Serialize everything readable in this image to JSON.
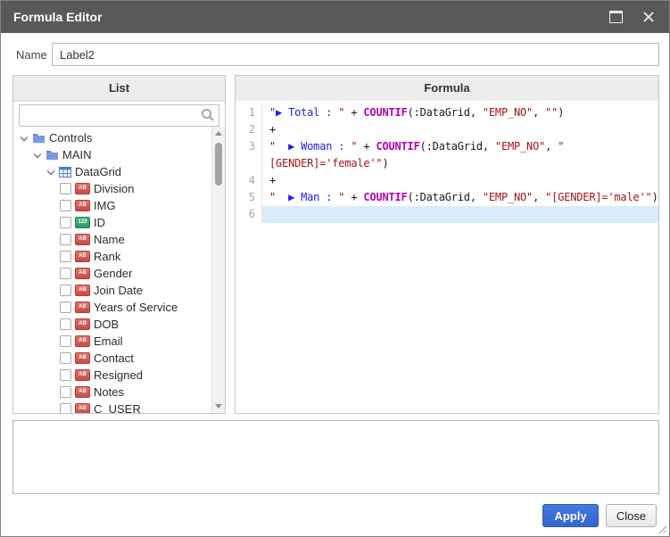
{
  "window": {
    "title": "Formula Editor"
  },
  "name_field": {
    "label": "Name",
    "value": "Label2"
  },
  "colors": {
    "titlebar": "#595959",
    "accent_blue": "#3a6bd3",
    "current_line_highlight": "#d9ecfb"
  },
  "list_panel": {
    "header": "List",
    "search_value": "",
    "field_icon_text": {
      "text": "AB",
      "number": "123"
    },
    "tree": [
      {
        "label": "Controls",
        "level": 0,
        "icon": "folder",
        "expandable": true,
        "checkbox": false
      },
      {
        "label": "MAIN",
        "level": 1,
        "icon": "folder",
        "expandable": true,
        "checkbox": false
      },
      {
        "label": "DataGrid",
        "level": 2,
        "icon": "grid",
        "expandable": true,
        "checkbox": false
      },
      {
        "label": "Division",
        "level": 3,
        "icon": "text",
        "checkbox": true,
        "checked": false
      },
      {
        "label": "IMG",
        "level": 3,
        "icon": "text",
        "checkbox": true,
        "checked": false
      },
      {
        "label": "ID",
        "level": 3,
        "icon": "number",
        "checkbox": true,
        "checked": false
      },
      {
        "label": "Name",
        "level": 3,
        "icon": "text",
        "checkbox": true,
        "checked": false
      },
      {
        "label": "Rank",
        "level": 3,
        "icon": "text",
        "checkbox": true,
        "checked": false
      },
      {
        "label": "Gender",
        "level": 3,
        "icon": "text",
        "checkbox": true,
        "checked": false
      },
      {
        "label": "Join Date",
        "level": 3,
        "icon": "text",
        "checkbox": true,
        "checked": false
      },
      {
        "label": "Years of Service",
        "level": 3,
        "icon": "text",
        "checkbox": true,
        "checked": false
      },
      {
        "label": "DOB",
        "level": 3,
        "icon": "text",
        "checkbox": true,
        "checked": false
      },
      {
        "label": "Email",
        "level": 3,
        "icon": "text",
        "checkbox": true,
        "checked": false
      },
      {
        "label": "Contact",
        "level": 3,
        "icon": "text",
        "checkbox": true,
        "checked": false
      },
      {
        "label": "Resigned",
        "level": 3,
        "icon": "text",
        "checkbox": true,
        "checked": false
      },
      {
        "label": "Notes",
        "level": 3,
        "icon": "text",
        "checkbox": true,
        "checked": false
      },
      {
        "label": "C_USER",
        "level": 3,
        "icon": "text",
        "checkbox": true,
        "checked": false
      }
    ]
  },
  "formula_panel": {
    "header": "Formula",
    "syntax_colors": {
      "str": "#a31515",
      "blue": "#1c1cf0",
      "kw": "#b400b4",
      "plain": "#1a1a1a"
    },
    "rows": [
      {
        "num": "1",
        "segments": [
          {
            "t": "\"",
            "s": "str"
          },
          {
            "t": "▶ Total : ",
            "s": "blue"
          },
          {
            "t": "\"",
            "s": "str"
          },
          {
            "t": " + ",
            "s": "plain"
          },
          {
            "t": "COUNTIF",
            "s": "kw"
          },
          {
            "t": "(:DataGrid, ",
            "s": "plain"
          },
          {
            "t": "\"EMP_NO\"",
            "s": "str"
          },
          {
            "t": ", ",
            "s": "plain"
          },
          {
            "t": "\"\"",
            "s": "str"
          },
          {
            "t": ")",
            "s": "plain"
          }
        ]
      },
      {
        "num": "2",
        "segments": [
          {
            "t": "+",
            "s": "plain"
          }
        ]
      },
      {
        "num": "3",
        "segments": [
          {
            "t": "\"  ",
            "s": "str"
          },
          {
            "t": "▶ Woman : ",
            "s": "blue"
          },
          {
            "t": "\"",
            "s": "str"
          },
          {
            "t": " + ",
            "s": "plain"
          },
          {
            "t": "COUNTIF",
            "s": "kw"
          },
          {
            "t": "(:DataGrid, ",
            "s": "plain"
          },
          {
            "t": "\"EMP_NO\"",
            "s": "str"
          },
          {
            "t": ", ",
            "s": "plain"
          },
          {
            "t": "\"",
            "s": "str"
          }
        ]
      },
      {
        "num": "",
        "segments": [
          {
            "t": "[GENDER]='female'\"",
            "s": "str"
          },
          {
            "t": ")",
            "s": "plain"
          }
        ]
      },
      {
        "num": "4",
        "segments": [
          {
            "t": "+",
            "s": "plain"
          }
        ]
      },
      {
        "num": "5",
        "segments": [
          {
            "t": "\"  ",
            "s": "str"
          },
          {
            "t": "▶ Man : ",
            "s": "blue"
          },
          {
            "t": "\"",
            "s": "str"
          },
          {
            "t": " + ",
            "s": "plain"
          },
          {
            "t": "COUNTIF",
            "s": "kw"
          },
          {
            "t": "(:DataGrid, ",
            "s": "plain"
          },
          {
            "t": "\"EMP_NO\"",
            "s": "str"
          },
          {
            "t": ", ",
            "s": "plain"
          },
          {
            "t": "\"[GENDER]='male'\"",
            "s": "str"
          },
          {
            "t": ")",
            "s": "plain"
          }
        ]
      },
      {
        "num": "6",
        "segments": [],
        "highlight": true
      }
    ]
  },
  "description_box": {
    "value": ""
  },
  "buttons": {
    "apply": "Apply",
    "close": "Close"
  }
}
